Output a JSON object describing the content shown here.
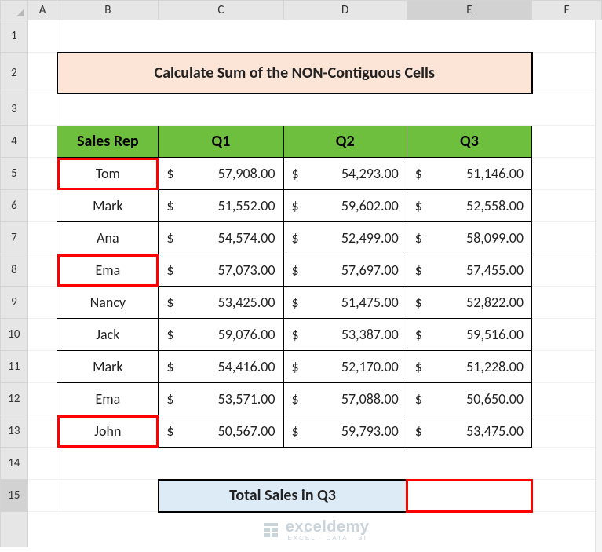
{
  "columns": [
    "",
    "A",
    "B",
    "C",
    "D",
    "E",
    "F"
  ],
  "rows": [
    "1",
    "2",
    "3",
    "4",
    "5",
    "6",
    "7",
    "8",
    "9",
    "10",
    "11",
    "12",
    "13",
    "14",
    "15"
  ],
  "title": "Calculate Sum of the NON-Contiguous Cells",
  "headers": {
    "rep": "Sales Rep",
    "q1": "Q1",
    "q2": "Q2",
    "q3": "Q3"
  },
  "data": [
    {
      "name": "Tom",
      "q1": "57,908.00",
      "q2": "54,293.00",
      "q3": "51,146.00",
      "hl": true
    },
    {
      "name": "Mark",
      "q1": "51,552.00",
      "q2": "59,602.00",
      "q3": "52,558.00",
      "hl": false
    },
    {
      "name": "Ana",
      "q1": "54,574.00",
      "q2": "52,499.00",
      "q3": "58,099.00",
      "hl": false
    },
    {
      "name": "Ema",
      "q1": "57,073.00",
      "q2": "57,697.00",
      "q3": "57,455.00",
      "hl": true
    },
    {
      "name": "Nancy",
      "q1": "53,425.00",
      "q2": "51,475.00",
      "q3": "52,822.00",
      "hl": false
    },
    {
      "name": "Jack",
      "q1": "59,076.00",
      "q2": "53,387.00",
      "q3": "59,516.00",
      "hl": false
    },
    {
      "name": "Mark",
      "q1": "54,416.00",
      "q2": "52,170.00",
      "q3": "51,228.00",
      "hl": false
    },
    {
      "name": "Ema",
      "q1": "53,571.00",
      "q2": "57,088.00",
      "q3": "50,650.00",
      "hl": false
    },
    {
      "name": "John",
      "q1": "50,567.00",
      "q2": "59,793.00",
      "q3": "53,475.00",
      "hl": true
    }
  ],
  "currency": "$",
  "total_label": "Total Sales in Q3",
  "total_value": "",
  "watermark": {
    "brand": "exceldemy",
    "sub": "EXCEL · DATA · BI"
  },
  "selected_cell": "E15",
  "selected_col": "E"
}
